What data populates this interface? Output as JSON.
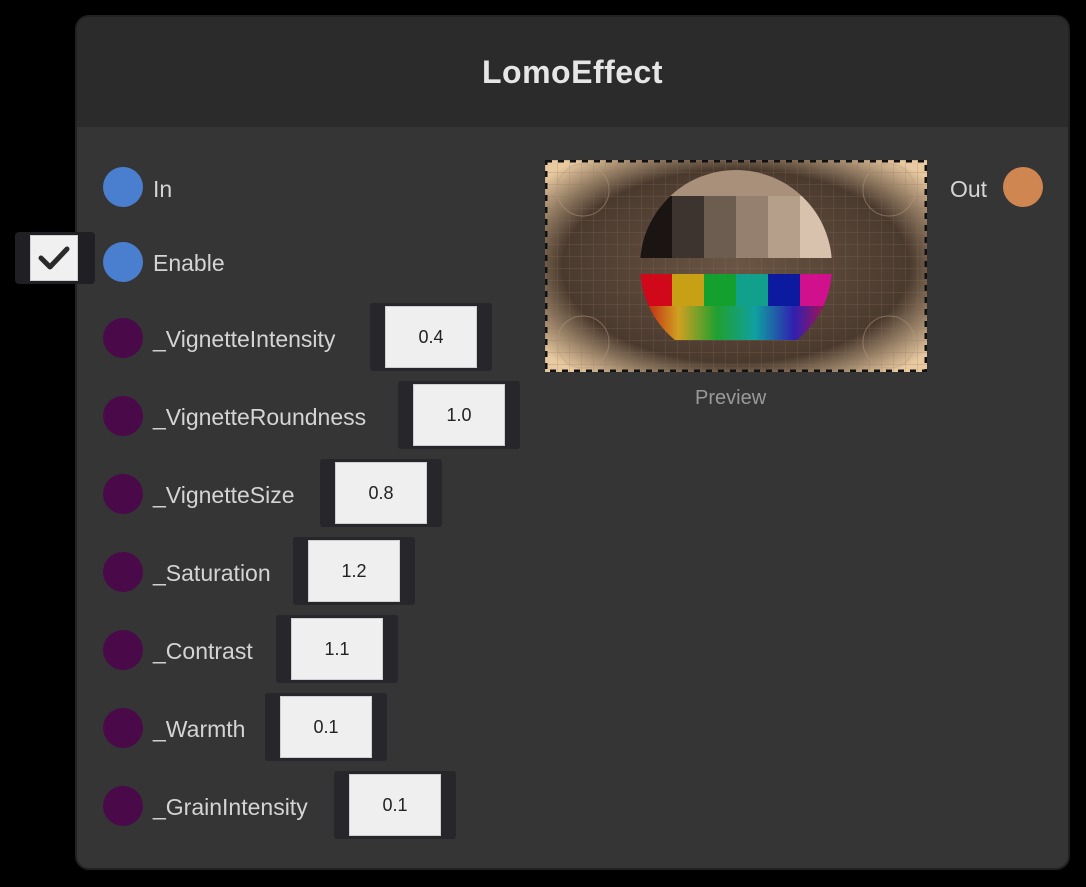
{
  "node": {
    "title": "LomoEffect",
    "inputs": {
      "in_label": "In",
      "enable_label": "Enable",
      "enable_checked": true
    },
    "properties": [
      {
        "label": "_VignetteIntensity",
        "value": "0.4"
      },
      {
        "label": "_VignetteRoundness",
        "value": "1.0"
      },
      {
        "label": "_VignetteSize",
        "value": "0.8"
      },
      {
        "label": "_Saturation",
        "value": "1.2"
      },
      {
        "label": "_Contrast",
        "value": "1.1"
      },
      {
        "label": "_Warmth",
        "value": "0.1"
      },
      {
        "label": "_GrainIntensity",
        "value": "0.1"
      }
    ],
    "preview": {
      "caption": "Preview",
      "bar_colors": [
        "#d0081a",
        "#c7a015",
        "#13a02e",
        "#11a08c",
        "#0c1aa0",
        "#d0108c"
      ],
      "gray_steps": [
        "#1a1512",
        "#3d3430",
        "#6d5c50",
        "#958070",
        "#b59e8a",
        "#d8c2ad"
      ]
    },
    "outputs": {
      "out_label": "Out"
    },
    "colors": {
      "input_port": "#4a7fcf",
      "property_port": "#4a0a4a",
      "output_port": "#d08650"
    }
  }
}
